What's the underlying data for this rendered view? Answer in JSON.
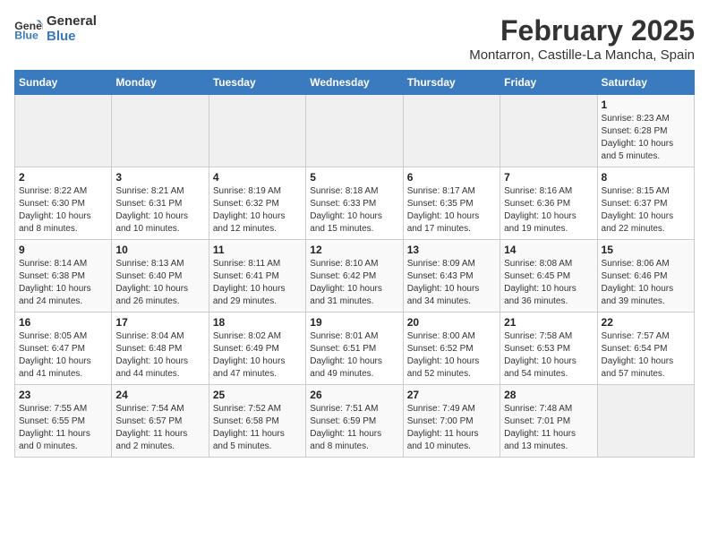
{
  "header": {
    "logo_line1": "General",
    "logo_line2": "Blue",
    "month": "February 2025",
    "location": "Montarron, Castille-La Mancha, Spain"
  },
  "days_of_week": [
    "Sunday",
    "Monday",
    "Tuesday",
    "Wednesday",
    "Thursday",
    "Friday",
    "Saturday"
  ],
  "weeks": [
    [
      {
        "day": "",
        "info": ""
      },
      {
        "day": "",
        "info": ""
      },
      {
        "day": "",
        "info": ""
      },
      {
        "day": "",
        "info": ""
      },
      {
        "day": "",
        "info": ""
      },
      {
        "day": "",
        "info": ""
      },
      {
        "day": "1",
        "info": "Sunrise: 8:23 AM\nSunset: 6:28 PM\nDaylight: 10 hours\nand 5 minutes."
      }
    ],
    [
      {
        "day": "2",
        "info": "Sunrise: 8:22 AM\nSunset: 6:30 PM\nDaylight: 10 hours\nand 8 minutes."
      },
      {
        "day": "3",
        "info": "Sunrise: 8:21 AM\nSunset: 6:31 PM\nDaylight: 10 hours\nand 10 minutes."
      },
      {
        "day": "4",
        "info": "Sunrise: 8:19 AM\nSunset: 6:32 PM\nDaylight: 10 hours\nand 12 minutes."
      },
      {
        "day": "5",
        "info": "Sunrise: 8:18 AM\nSunset: 6:33 PM\nDaylight: 10 hours\nand 15 minutes."
      },
      {
        "day": "6",
        "info": "Sunrise: 8:17 AM\nSunset: 6:35 PM\nDaylight: 10 hours\nand 17 minutes."
      },
      {
        "day": "7",
        "info": "Sunrise: 8:16 AM\nSunset: 6:36 PM\nDaylight: 10 hours\nand 19 minutes."
      },
      {
        "day": "8",
        "info": "Sunrise: 8:15 AM\nSunset: 6:37 PM\nDaylight: 10 hours\nand 22 minutes."
      }
    ],
    [
      {
        "day": "9",
        "info": "Sunrise: 8:14 AM\nSunset: 6:38 PM\nDaylight: 10 hours\nand 24 minutes."
      },
      {
        "day": "10",
        "info": "Sunrise: 8:13 AM\nSunset: 6:40 PM\nDaylight: 10 hours\nand 26 minutes."
      },
      {
        "day": "11",
        "info": "Sunrise: 8:11 AM\nSunset: 6:41 PM\nDaylight: 10 hours\nand 29 minutes."
      },
      {
        "day": "12",
        "info": "Sunrise: 8:10 AM\nSunset: 6:42 PM\nDaylight: 10 hours\nand 31 minutes."
      },
      {
        "day": "13",
        "info": "Sunrise: 8:09 AM\nSunset: 6:43 PM\nDaylight: 10 hours\nand 34 minutes."
      },
      {
        "day": "14",
        "info": "Sunrise: 8:08 AM\nSunset: 6:45 PM\nDaylight: 10 hours\nand 36 minutes."
      },
      {
        "day": "15",
        "info": "Sunrise: 8:06 AM\nSunset: 6:46 PM\nDaylight: 10 hours\nand 39 minutes."
      }
    ],
    [
      {
        "day": "16",
        "info": "Sunrise: 8:05 AM\nSunset: 6:47 PM\nDaylight: 10 hours\nand 41 minutes."
      },
      {
        "day": "17",
        "info": "Sunrise: 8:04 AM\nSunset: 6:48 PM\nDaylight: 10 hours\nand 44 minutes."
      },
      {
        "day": "18",
        "info": "Sunrise: 8:02 AM\nSunset: 6:49 PM\nDaylight: 10 hours\nand 47 minutes."
      },
      {
        "day": "19",
        "info": "Sunrise: 8:01 AM\nSunset: 6:51 PM\nDaylight: 10 hours\nand 49 minutes."
      },
      {
        "day": "20",
        "info": "Sunrise: 8:00 AM\nSunset: 6:52 PM\nDaylight: 10 hours\nand 52 minutes."
      },
      {
        "day": "21",
        "info": "Sunrise: 7:58 AM\nSunset: 6:53 PM\nDaylight: 10 hours\nand 54 minutes."
      },
      {
        "day": "22",
        "info": "Sunrise: 7:57 AM\nSunset: 6:54 PM\nDaylight: 10 hours\nand 57 minutes."
      }
    ],
    [
      {
        "day": "23",
        "info": "Sunrise: 7:55 AM\nSunset: 6:55 PM\nDaylight: 11 hours\nand 0 minutes."
      },
      {
        "day": "24",
        "info": "Sunrise: 7:54 AM\nSunset: 6:57 PM\nDaylight: 11 hours\nand 2 minutes."
      },
      {
        "day": "25",
        "info": "Sunrise: 7:52 AM\nSunset: 6:58 PM\nDaylight: 11 hours\nand 5 minutes."
      },
      {
        "day": "26",
        "info": "Sunrise: 7:51 AM\nSunset: 6:59 PM\nDaylight: 11 hours\nand 8 minutes."
      },
      {
        "day": "27",
        "info": "Sunrise: 7:49 AM\nSunset: 7:00 PM\nDaylight: 11 hours\nand 10 minutes."
      },
      {
        "day": "28",
        "info": "Sunrise: 7:48 AM\nSunset: 7:01 PM\nDaylight: 11 hours\nand 13 minutes."
      },
      {
        "day": "",
        "info": ""
      }
    ]
  ]
}
